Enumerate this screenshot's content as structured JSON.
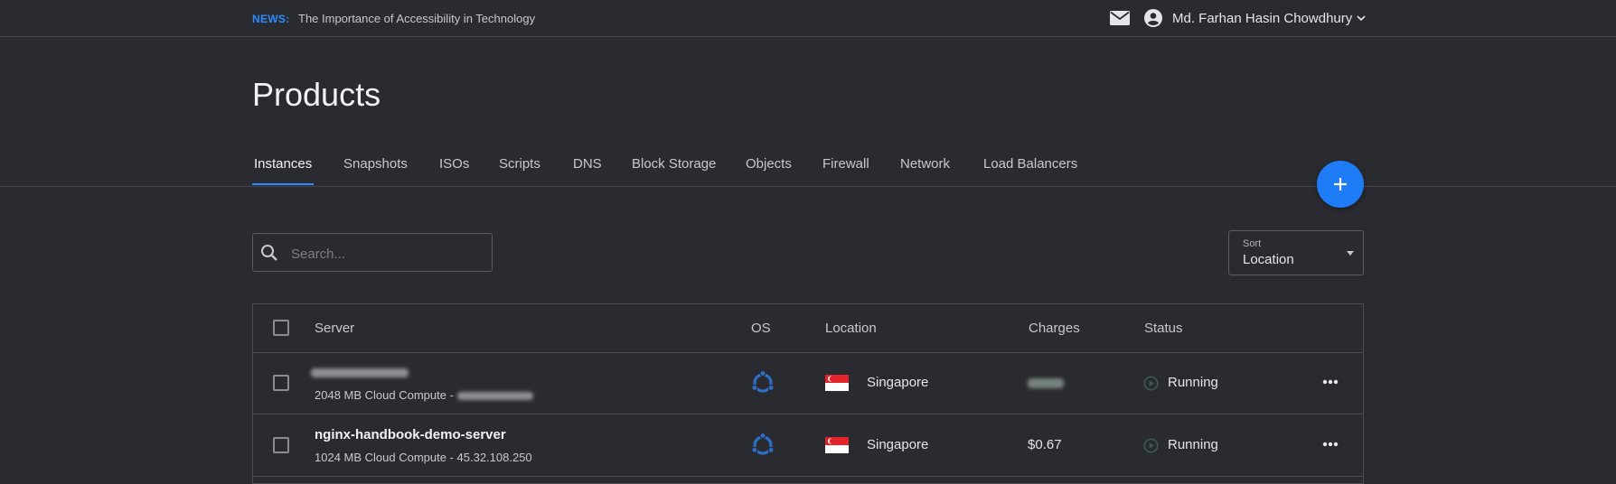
{
  "news": {
    "tag": "NEWS:",
    "text": "The Importance of Accessibility in Technology"
  },
  "user": {
    "name": "Md. Farhan Hasin Chowdhury",
    "mail_icon": "mail-icon",
    "avatar_icon": "account-circle-icon"
  },
  "page": {
    "title": "Products"
  },
  "tabs": [
    {
      "label": "Instances",
      "active": true
    },
    {
      "label": "Snapshots"
    },
    {
      "label": "ISOs"
    },
    {
      "label": "Scripts"
    },
    {
      "label": "DNS"
    },
    {
      "label": "Block Storage"
    },
    {
      "label": "Objects"
    },
    {
      "label": "Firewall"
    },
    {
      "label": "Network"
    },
    {
      "label": "Load Balancers"
    }
  ],
  "fab": {
    "icon": "plus-icon"
  },
  "search": {
    "placeholder": "Search..."
  },
  "sort": {
    "label": "Sort",
    "value": "Location"
  },
  "table": {
    "headers": {
      "server": "Server",
      "os": "OS",
      "location": "Location",
      "charges": "Charges",
      "status": "Status"
    },
    "rows": [
      {
        "name": "",
        "sub": "2048 MB Cloud Compute - ",
        "os_icon": "ubuntu-icon",
        "location": "Singapore",
        "charges": "",
        "status": "Running"
      },
      {
        "name": "nginx-handbook-demo-server",
        "sub": "1024 MB Cloud Compute - 45.32.108.250",
        "os_icon": "ubuntu-icon",
        "location": "Singapore",
        "charges": "$0.67",
        "status": "Running"
      }
    ]
  },
  "colors": {
    "background": "#2a2b30",
    "accent": "#2a8cff",
    "fab": "#1e7cf7",
    "ubuntu": "#2d6fc8"
  }
}
